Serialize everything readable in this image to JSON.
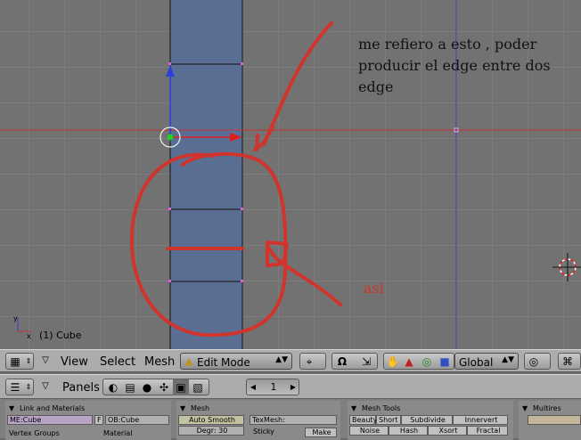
{
  "viewport": {
    "annotation_lines": [
      "me refiero a esto , poder",
      "producir el edge entre dos",
      "edge"
    ],
    "annotation_word": "asi",
    "object_label": "(1) Cube",
    "colors": {
      "mesh_fill": "#5a6e94",
      "red_ink": "#d0342c",
      "x_axis": "#c83232",
      "y_axis": "#3c3ccc"
    }
  },
  "view_header": {
    "menus": [
      "View",
      "Select",
      "Mesh"
    ],
    "mode_select": "Edit Mode",
    "orientation_select": "Global",
    "icons": [
      "view-type-icon",
      "pivot-icon",
      "magnet-icon",
      "hand-icon",
      "triangle-icon",
      "circle-icon",
      "proportional-icon",
      "snap-icon"
    ]
  },
  "buttons_header": {
    "panels_label": "Panels",
    "frame_number": "1",
    "icons": [
      "logic-icon",
      "script-icon",
      "shading-icon",
      "object-icon",
      "editing-icon",
      "scene-icon"
    ]
  },
  "panels": {
    "link_materials": {
      "title": "Link and Materials",
      "me_field": "ME:Cube",
      "f_label": "F",
      "ob_field": "OB:Cube",
      "vertex_groups": "Vertex Groups",
      "material": "Material"
    },
    "mesh": {
      "title": "Mesh",
      "auto_smooth": "Auto Smooth",
      "degr": "Degr: 30",
      "texmesh": "TexMesh:",
      "sticky": "Sticky",
      "make": "Make"
    },
    "mesh_tools": {
      "title": "Mesh Tools",
      "row1": [
        "Beauty",
        "Short",
        "Subdivide",
        "Innervert"
      ],
      "row2": [
        "Noise",
        "Hash",
        "Xsort",
        "Fractal"
      ]
    },
    "multires": {
      "title": "Multires"
    }
  }
}
